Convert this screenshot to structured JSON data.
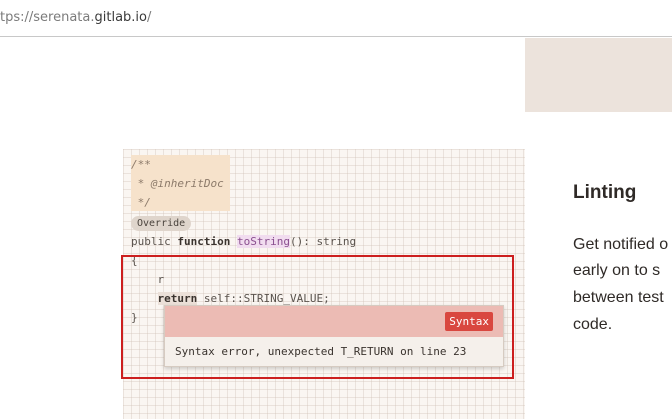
{
  "browser": {
    "url_prefix": "tps://serenata.",
    "url_domain": "gitlab.io",
    "url_suffix": "/"
  },
  "code": {
    "line1": "/**",
    "line2": " * @inheritDoc",
    "line3": " */",
    "override_badge": "Override",
    "sig_pre": "public ",
    "sig_kw": "function",
    "sig_sp": " ",
    "sig_fn": "toString",
    "sig_post": "(): string",
    "open_brace": "{",
    "r_line": "    r",
    "ret_indent": "    ",
    "ret_kw": "return",
    "ret_rest": " self::STRING_VALUE;",
    "close_brace": "}"
  },
  "tooltip": {
    "badge": "Syntax",
    "message": "Syntax error, unexpected T_RETURN on line 23"
  },
  "feature": {
    "title": "Linting",
    "line1": "Get notified o",
    "line2": "early on to s",
    "line3": "between test",
    "line4": "code."
  },
  "colors": {
    "error_border": "#cc1f1f",
    "badge_red": "#d9473f",
    "tooltip_header": "#ecbbb4"
  }
}
